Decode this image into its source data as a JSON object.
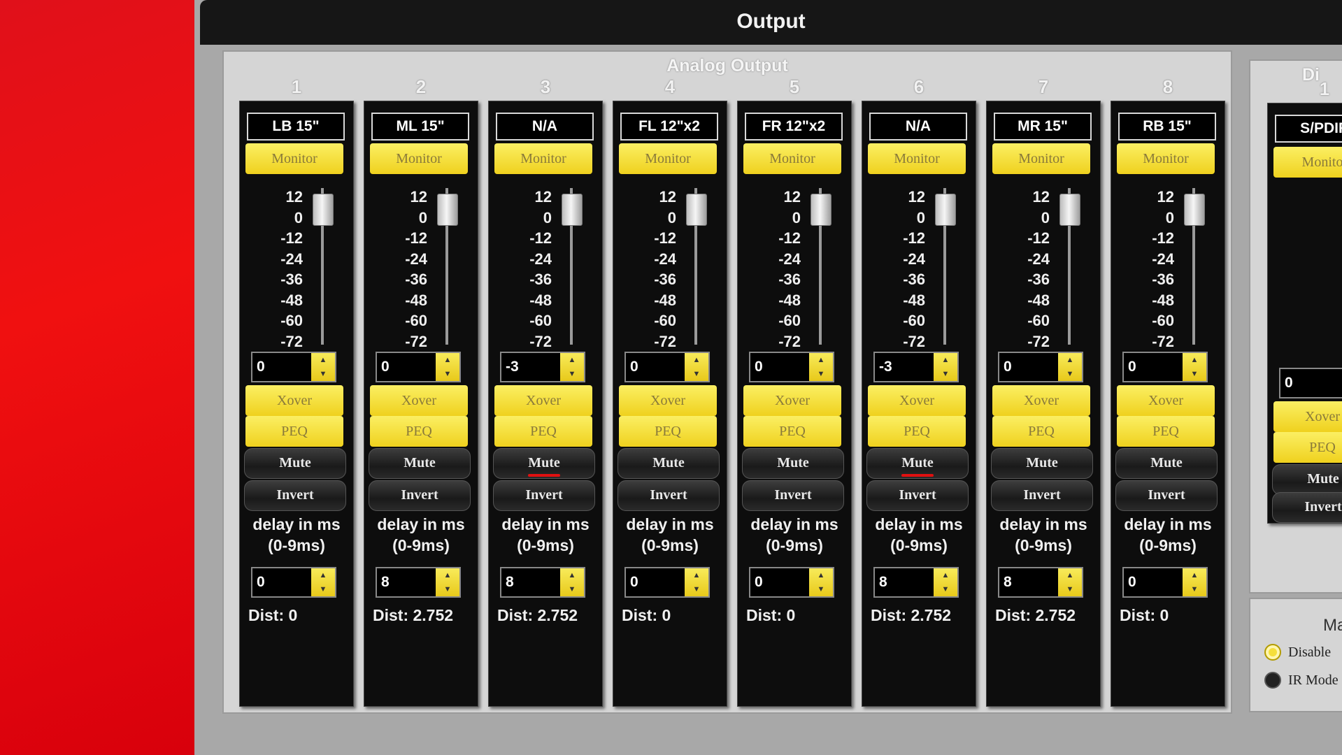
{
  "window": {
    "title": "Output"
  },
  "analog_output": {
    "title": "Analog Output",
    "scale_labels": [
      "12",
      "0",
      "-12",
      "-24",
      "-36",
      "-48",
      "-60",
      "-72"
    ],
    "channels": [
      {
        "number": "1",
        "name": "LB 15\"",
        "monitor": "Monitor",
        "gain": "0",
        "xover": "Xover",
        "peq": "PEQ",
        "mute": "Mute",
        "mute_active": false,
        "invert": "Invert",
        "delay_label": "delay in ms",
        "delay_range": "(0-9ms)",
        "delay": "0",
        "dist": "Dist: 0"
      },
      {
        "number": "2",
        "name": "ML 15\"",
        "monitor": "Monitor",
        "gain": "0",
        "xover": "Xover",
        "peq": "PEQ",
        "mute": "Mute",
        "mute_active": false,
        "invert": "Invert",
        "delay_label": "delay in ms",
        "delay_range": "(0-9ms)",
        "delay": "8",
        "dist": "Dist: 2.752"
      },
      {
        "number": "3",
        "name": "N/A",
        "monitor": "Monitor",
        "gain": "-3",
        "xover": "Xover",
        "peq": "PEQ",
        "mute": "Mute",
        "mute_active": true,
        "invert": "Invert",
        "delay_label": "delay in ms",
        "delay_range": "(0-9ms)",
        "delay": "8",
        "dist": "Dist: 2.752"
      },
      {
        "number": "4",
        "name": "FL 12\"x2",
        "monitor": "Monitor",
        "gain": "0",
        "xover": "Xover",
        "peq": "PEQ",
        "mute": "Mute",
        "mute_active": false,
        "invert": "Invert",
        "delay_label": "delay in ms",
        "delay_range": "(0-9ms)",
        "delay": "0",
        "dist": "Dist: 0"
      },
      {
        "number": "5",
        "name": "FR 12\"x2",
        "monitor": "Monitor",
        "gain": "0",
        "xover": "Xover",
        "peq": "PEQ",
        "mute": "Mute",
        "mute_active": false,
        "invert": "Invert",
        "delay_label": "delay in ms",
        "delay_range": "(0-9ms)",
        "delay": "0",
        "dist": "Dist: 0"
      },
      {
        "number": "6",
        "name": "N/A",
        "monitor": "Monitor",
        "gain": "-3",
        "xover": "Xover",
        "peq": "PEQ",
        "mute": "Mute",
        "mute_active": true,
        "invert": "Invert",
        "delay_label": "delay in ms",
        "delay_range": "(0-9ms)",
        "delay": "8",
        "dist": "Dist: 2.752"
      },
      {
        "number": "7",
        "name": "MR 15\"",
        "monitor": "Monitor",
        "gain": "0",
        "xover": "Xover",
        "peq": "PEQ",
        "mute": "Mute",
        "mute_active": false,
        "invert": "Invert",
        "delay_label": "delay in ms",
        "delay_range": "(0-9ms)",
        "delay": "8",
        "dist": "Dist: 2.752"
      },
      {
        "number": "8",
        "name": "RB 15\"",
        "monitor": "Monitor",
        "gain": "0",
        "xover": "Xover",
        "peq": "PEQ",
        "mute": "Mute",
        "mute_active": false,
        "invert": "Invert",
        "delay_label": "delay in ms",
        "delay_range": "(0-9ms)",
        "delay": "0",
        "dist": "Dist: 0"
      }
    ]
  },
  "digital_output": {
    "title_partial": "Di",
    "channel": {
      "number": "1",
      "name": "S/PDIF",
      "monitor": "Monito",
      "gain": "0",
      "xover": "Xover",
      "peq": "PEQ",
      "mute": "Mute",
      "invert": "Invert"
    }
  },
  "mode_panel": {
    "title_partial": "Ma",
    "options": [
      {
        "label": "Disable",
        "selected": true
      },
      {
        "label": "IR Mode",
        "selected": false
      }
    ]
  },
  "colors": {
    "button_yellow": "#f5df3c",
    "strip_black": "#0d0d0d",
    "mute_led": "#e01010",
    "background_red": "#e8101a"
  },
  "icons": {
    "spin_arrows": "up-down-arrow-icon",
    "fader": "fader-knob-icon"
  }
}
